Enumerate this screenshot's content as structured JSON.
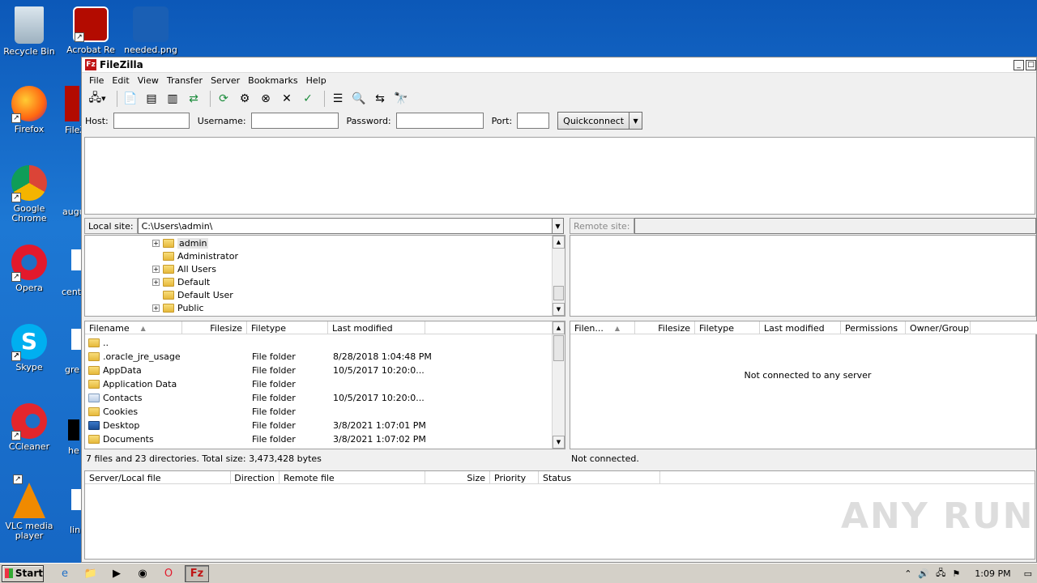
{
  "desktop": {
    "icons": [
      {
        "label": "Recycle Bin"
      },
      {
        "label": "Acrobat Re"
      },
      {
        "label": "needed.png"
      },
      {
        "label": "Firefox"
      },
      {
        "label": "FileZ"
      },
      {
        "label": "Google Chrome"
      },
      {
        "label": "augu"
      },
      {
        "label": "Opera"
      },
      {
        "label": "cent"
      },
      {
        "label": "Skype"
      },
      {
        "label": "gre"
      },
      {
        "label": "CCleaner"
      },
      {
        "label": "he"
      },
      {
        "label": "VLC media player"
      },
      {
        "label": "lin"
      }
    ]
  },
  "window": {
    "title": "FileZilla",
    "menu": [
      "File",
      "Edit",
      "View",
      "Transfer",
      "Server",
      "Bookmarks",
      "Help"
    ],
    "quickconnect": {
      "host_label": "Host:",
      "username_label": "Username:",
      "password_label": "Password:",
      "port_label": "Port:",
      "host_value": "",
      "username_value": "",
      "password_value": "",
      "port_value": "",
      "button_label": "Quickconnect"
    },
    "local": {
      "site_label": "Local site:",
      "path": "C:\\Users\\admin\\",
      "tree": [
        "admin",
        "Administrator",
        "All Users",
        "Default",
        "Default User",
        "Public"
      ],
      "columns": [
        "Filename",
        "Filesize",
        "Filetype",
        "Last modified"
      ],
      "files": [
        {
          "name": "..",
          "type": "",
          "modified": ""
        },
        {
          "name": ".oracle_jre_usage",
          "type": "File folder",
          "modified": "8/28/2018 1:04:48 PM"
        },
        {
          "name": "AppData",
          "type": "File folder",
          "modified": "10/5/2017 10:20:0..."
        },
        {
          "name": "Application Data",
          "type": "File folder",
          "modified": ""
        },
        {
          "name": "Contacts",
          "type": "File folder",
          "modified": "10/5/2017 10:20:0..."
        },
        {
          "name": "Cookies",
          "type": "File folder",
          "modified": ""
        },
        {
          "name": "Desktop",
          "type": "File folder",
          "modified": "3/8/2021 1:07:01 PM"
        },
        {
          "name": "Documents",
          "type": "File folder",
          "modified": "3/8/2021 1:07:02 PM"
        }
      ],
      "status": "7 files and 23 directories. Total size: 3,473,428 bytes"
    },
    "remote": {
      "site_label": "Remote site:",
      "columns": [
        "Filen...",
        "Filesize",
        "Filetype",
        "Last modified",
        "Permissions",
        "Owner/Group"
      ],
      "empty_message": "Not connected to any server",
      "status": "Not connected."
    },
    "queue": {
      "columns": [
        "Server/Local file",
        "Direction",
        "Remote file",
        "Size",
        "Priority",
        "Status"
      ]
    }
  },
  "taskbar": {
    "start_label": "Start",
    "clock": "1:09 PM"
  },
  "watermark": "ANY RUN"
}
